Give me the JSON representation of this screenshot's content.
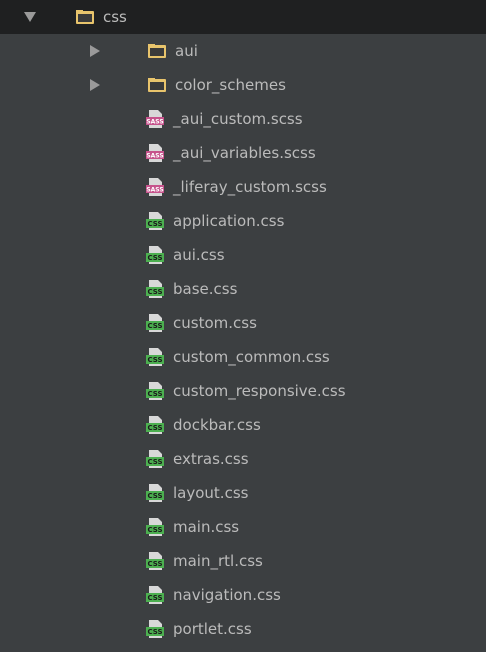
{
  "tree": {
    "root": {
      "name": "css",
      "expanded": true,
      "icon": "folder-icon"
    },
    "folders": [
      {
        "name": "aui",
        "expanded": false,
        "icon": "folder-icon"
      },
      {
        "name": "color_schemes",
        "expanded": false,
        "icon": "folder-icon"
      }
    ],
    "files": [
      {
        "name": "_aui_custom.scss",
        "type": "sass",
        "icon": "sass-file-icon"
      },
      {
        "name": "_aui_variables.scss",
        "type": "sass",
        "icon": "sass-file-icon"
      },
      {
        "name": "_liferay_custom.scss",
        "type": "sass",
        "icon": "sass-file-icon"
      },
      {
        "name": "application.css",
        "type": "css",
        "icon": "css-file-icon"
      },
      {
        "name": "aui.css",
        "type": "css",
        "icon": "css-file-icon"
      },
      {
        "name": "base.css",
        "type": "css",
        "icon": "css-file-icon"
      },
      {
        "name": "custom.css",
        "type": "css",
        "icon": "css-file-icon"
      },
      {
        "name": "custom_common.css",
        "type": "css",
        "icon": "css-file-icon"
      },
      {
        "name": "custom_responsive.css",
        "type": "css",
        "icon": "css-file-icon"
      },
      {
        "name": "dockbar.css",
        "type": "css",
        "icon": "css-file-icon"
      },
      {
        "name": "extras.css",
        "type": "css",
        "icon": "css-file-icon"
      },
      {
        "name": "layout.css",
        "type": "css",
        "icon": "css-file-icon"
      },
      {
        "name": "main.css",
        "type": "css",
        "icon": "css-file-icon"
      },
      {
        "name": "main_rtl.css",
        "type": "css",
        "icon": "css-file-icon"
      },
      {
        "name": "navigation.css",
        "type": "css",
        "icon": "css-file-icon"
      },
      {
        "name": "portlet.css",
        "type": "css",
        "icon": "css-file-icon"
      }
    ],
    "colors": {
      "background": "#3c3f41",
      "selected_row": "#1f2021",
      "text": "#bbbbbb",
      "folder": "#e8c46c",
      "sass_badge": "#c6538c",
      "css_badge": "#4caf50"
    }
  }
}
